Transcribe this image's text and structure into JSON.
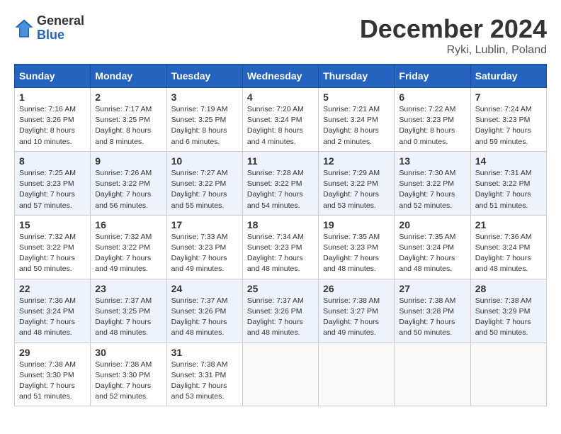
{
  "header": {
    "logo_general": "General",
    "logo_blue": "Blue",
    "title": "December 2024",
    "location": "Ryki, Lublin, Poland"
  },
  "weekdays": [
    "Sunday",
    "Monday",
    "Tuesday",
    "Wednesday",
    "Thursday",
    "Friday",
    "Saturday"
  ],
  "weeks": [
    [
      {
        "day": "1",
        "sunrise": "Sunrise: 7:16 AM",
        "sunset": "Sunset: 3:26 PM",
        "daylight": "Daylight: 8 hours and 10 minutes."
      },
      {
        "day": "2",
        "sunrise": "Sunrise: 7:17 AM",
        "sunset": "Sunset: 3:25 PM",
        "daylight": "Daylight: 8 hours and 8 minutes."
      },
      {
        "day": "3",
        "sunrise": "Sunrise: 7:19 AM",
        "sunset": "Sunset: 3:25 PM",
        "daylight": "Daylight: 8 hours and 6 minutes."
      },
      {
        "day": "4",
        "sunrise": "Sunrise: 7:20 AM",
        "sunset": "Sunset: 3:24 PM",
        "daylight": "Daylight: 8 hours and 4 minutes."
      },
      {
        "day": "5",
        "sunrise": "Sunrise: 7:21 AM",
        "sunset": "Sunset: 3:24 PM",
        "daylight": "Daylight: 8 hours and 2 minutes."
      },
      {
        "day": "6",
        "sunrise": "Sunrise: 7:22 AM",
        "sunset": "Sunset: 3:23 PM",
        "daylight": "Daylight: 8 hours and 0 minutes."
      },
      {
        "day": "7",
        "sunrise": "Sunrise: 7:24 AM",
        "sunset": "Sunset: 3:23 PM",
        "daylight": "Daylight: 7 hours and 59 minutes."
      }
    ],
    [
      {
        "day": "8",
        "sunrise": "Sunrise: 7:25 AM",
        "sunset": "Sunset: 3:23 PM",
        "daylight": "Daylight: 7 hours and 57 minutes."
      },
      {
        "day": "9",
        "sunrise": "Sunrise: 7:26 AM",
        "sunset": "Sunset: 3:22 PM",
        "daylight": "Daylight: 7 hours and 56 minutes."
      },
      {
        "day": "10",
        "sunrise": "Sunrise: 7:27 AM",
        "sunset": "Sunset: 3:22 PM",
        "daylight": "Daylight: 7 hours and 55 minutes."
      },
      {
        "day": "11",
        "sunrise": "Sunrise: 7:28 AM",
        "sunset": "Sunset: 3:22 PM",
        "daylight": "Daylight: 7 hours and 54 minutes."
      },
      {
        "day": "12",
        "sunrise": "Sunrise: 7:29 AM",
        "sunset": "Sunset: 3:22 PM",
        "daylight": "Daylight: 7 hours and 53 minutes."
      },
      {
        "day": "13",
        "sunrise": "Sunrise: 7:30 AM",
        "sunset": "Sunset: 3:22 PM",
        "daylight": "Daylight: 7 hours and 52 minutes."
      },
      {
        "day": "14",
        "sunrise": "Sunrise: 7:31 AM",
        "sunset": "Sunset: 3:22 PM",
        "daylight": "Daylight: 7 hours and 51 minutes."
      }
    ],
    [
      {
        "day": "15",
        "sunrise": "Sunrise: 7:32 AM",
        "sunset": "Sunset: 3:22 PM",
        "daylight": "Daylight: 7 hours and 50 minutes."
      },
      {
        "day": "16",
        "sunrise": "Sunrise: 7:32 AM",
        "sunset": "Sunset: 3:22 PM",
        "daylight": "Daylight: 7 hours and 49 minutes."
      },
      {
        "day": "17",
        "sunrise": "Sunrise: 7:33 AM",
        "sunset": "Sunset: 3:23 PM",
        "daylight": "Daylight: 7 hours and 49 minutes."
      },
      {
        "day": "18",
        "sunrise": "Sunrise: 7:34 AM",
        "sunset": "Sunset: 3:23 PM",
        "daylight": "Daylight: 7 hours and 48 minutes."
      },
      {
        "day": "19",
        "sunrise": "Sunrise: 7:35 AM",
        "sunset": "Sunset: 3:23 PM",
        "daylight": "Daylight: 7 hours and 48 minutes."
      },
      {
        "day": "20",
        "sunrise": "Sunrise: 7:35 AM",
        "sunset": "Sunset: 3:24 PM",
        "daylight": "Daylight: 7 hours and 48 minutes."
      },
      {
        "day": "21",
        "sunrise": "Sunrise: 7:36 AM",
        "sunset": "Sunset: 3:24 PM",
        "daylight": "Daylight: 7 hours and 48 minutes."
      }
    ],
    [
      {
        "day": "22",
        "sunrise": "Sunrise: 7:36 AM",
        "sunset": "Sunset: 3:24 PM",
        "daylight": "Daylight: 7 hours and 48 minutes."
      },
      {
        "day": "23",
        "sunrise": "Sunrise: 7:37 AM",
        "sunset": "Sunset: 3:25 PM",
        "daylight": "Daylight: 7 hours and 48 minutes."
      },
      {
        "day": "24",
        "sunrise": "Sunrise: 7:37 AM",
        "sunset": "Sunset: 3:26 PM",
        "daylight": "Daylight: 7 hours and 48 minutes."
      },
      {
        "day": "25",
        "sunrise": "Sunrise: 7:37 AM",
        "sunset": "Sunset: 3:26 PM",
        "daylight": "Daylight: 7 hours and 48 minutes."
      },
      {
        "day": "26",
        "sunrise": "Sunrise: 7:38 AM",
        "sunset": "Sunset: 3:27 PM",
        "daylight": "Daylight: 7 hours and 49 minutes."
      },
      {
        "day": "27",
        "sunrise": "Sunrise: 7:38 AM",
        "sunset": "Sunset: 3:28 PM",
        "daylight": "Daylight: 7 hours and 50 minutes."
      },
      {
        "day": "28",
        "sunrise": "Sunrise: 7:38 AM",
        "sunset": "Sunset: 3:29 PM",
        "daylight": "Daylight: 7 hours and 50 minutes."
      }
    ],
    [
      {
        "day": "29",
        "sunrise": "Sunrise: 7:38 AM",
        "sunset": "Sunset: 3:30 PM",
        "daylight": "Daylight: 7 hours and 51 minutes."
      },
      {
        "day": "30",
        "sunrise": "Sunrise: 7:38 AM",
        "sunset": "Sunset: 3:30 PM",
        "daylight": "Daylight: 7 hours and 52 minutes."
      },
      {
        "day": "31",
        "sunrise": "Sunrise: 7:38 AM",
        "sunset": "Sunset: 3:31 PM",
        "daylight": "Daylight: 7 hours and 53 minutes."
      },
      null,
      null,
      null,
      null
    ]
  ]
}
